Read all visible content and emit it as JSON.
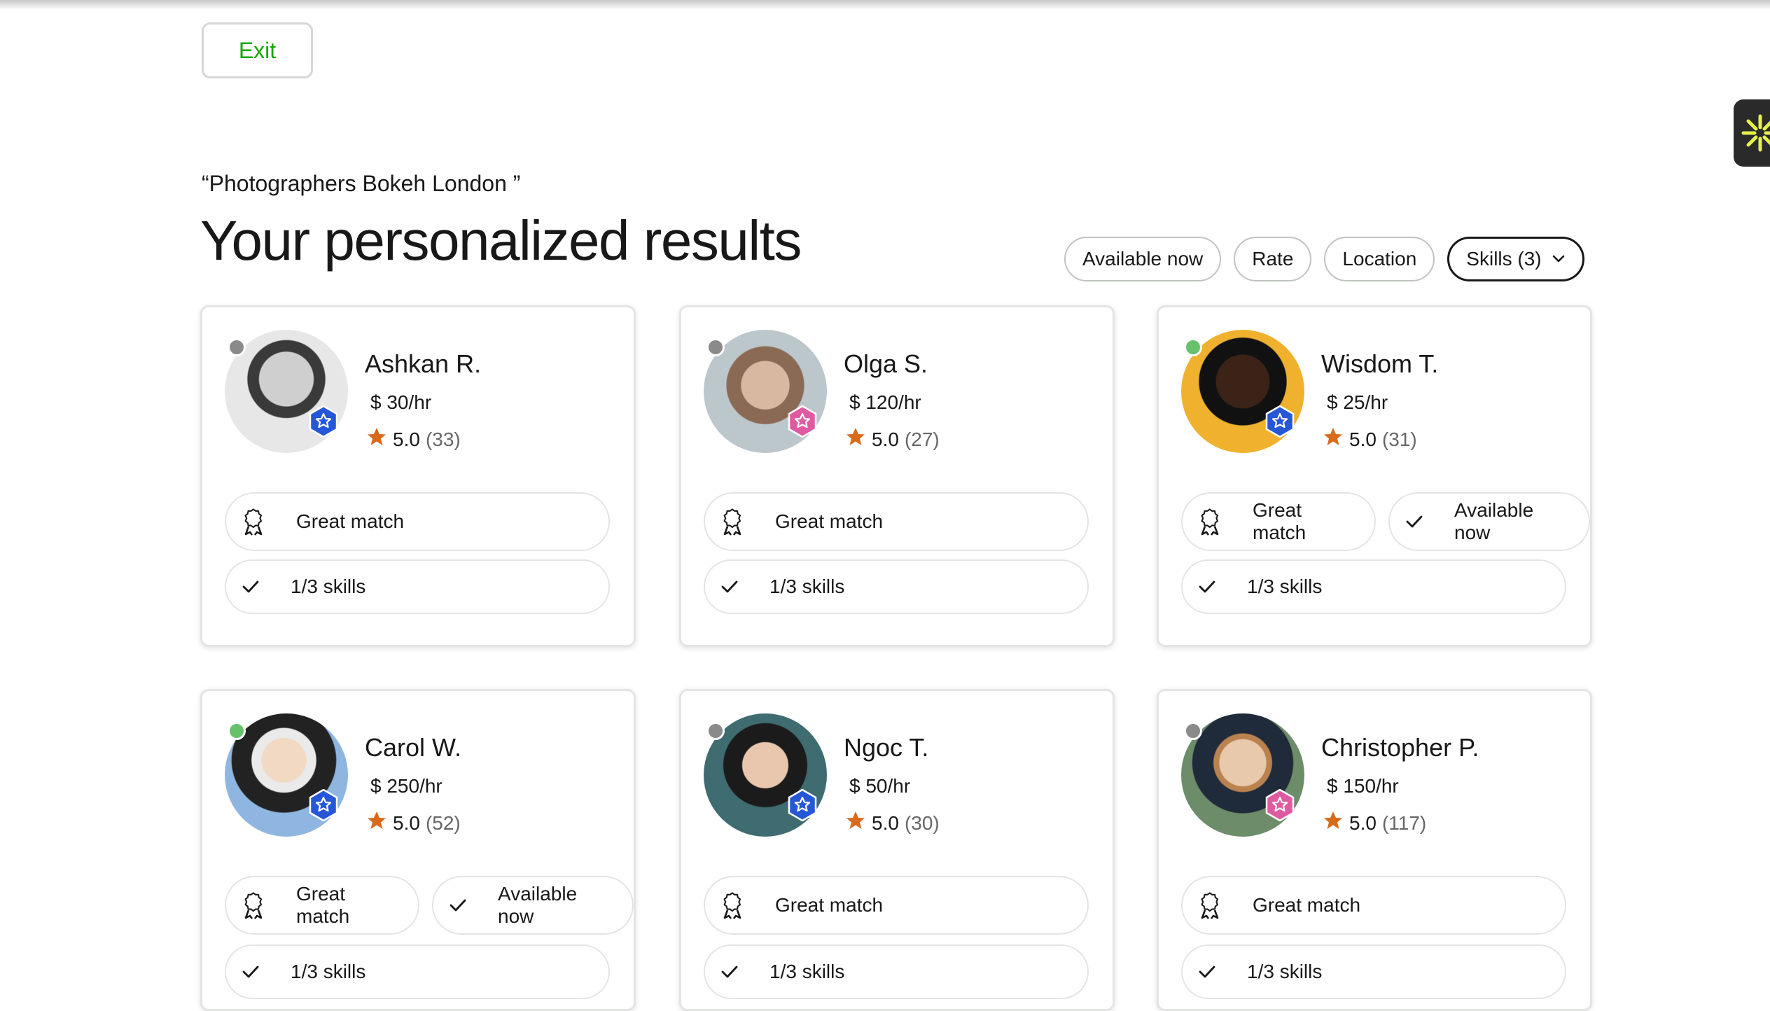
{
  "header": {
    "exit_label": "Exit",
    "query": "“Photographers Bokeh London ”",
    "title": "Your personalized results"
  },
  "filters": [
    {
      "label": "Available now"
    },
    {
      "label": "Rate"
    },
    {
      "label": "Location"
    },
    {
      "label": "Skills (3)"
    }
  ],
  "colors": {
    "brand_green": "#14a800",
    "star_orange": "#d86a1c",
    "badge_blue": "#2557d6",
    "badge_pink": "#e05aa2",
    "online_green": "#67c16b",
    "offline_gray": "#8a8a8a"
  },
  "freelancers": [
    {
      "name": "Ashkan R.",
      "rate": "$ 30/hr",
      "rating": "5.0",
      "reviews": "(33)",
      "online": false,
      "badge": "blue",
      "tags": [
        "Great match"
      ],
      "skills": "1/3 skills"
    },
    {
      "name": "Olga S.",
      "rate": "$ 120/hr",
      "rating": "5.0",
      "reviews": "(27)",
      "online": false,
      "badge": "pink",
      "tags": [
        "Great match"
      ],
      "skills": "1/3 skills"
    },
    {
      "name": "Wisdom T.",
      "rate": "$ 25/hr",
      "rating": "5.0",
      "reviews": "(31)",
      "online": true,
      "badge": "blue",
      "tags": [
        "Great match",
        "Available now"
      ],
      "skills": "1/3 skills"
    },
    {
      "name": "Carol W.",
      "rate": "$ 250/hr",
      "rating": "5.0",
      "reviews": "(52)",
      "online": true,
      "badge": "blue",
      "tags": [
        "Great match",
        "Available now"
      ],
      "skills": "1/3 skills"
    },
    {
      "name": "Ngoc T.",
      "rate": "$ 50/hr",
      "rating": "5.0",
      "reviews": "(30)",
      "online": false,
      "badge": "blue",
      "tags": [
        "Great match"
      ],
      "skills": "1/3 skills"
    },
    {
      "name": "Christopher P.",
      "rate": "$ 150/hr",
      "rating": "5.0",
      "reviews": "(117)",
      "online": false,
      "badge": "pink",
      "tags": [
        "Great match"
      ],
      "skills": "1/3 skills"
    }
  ]
}
